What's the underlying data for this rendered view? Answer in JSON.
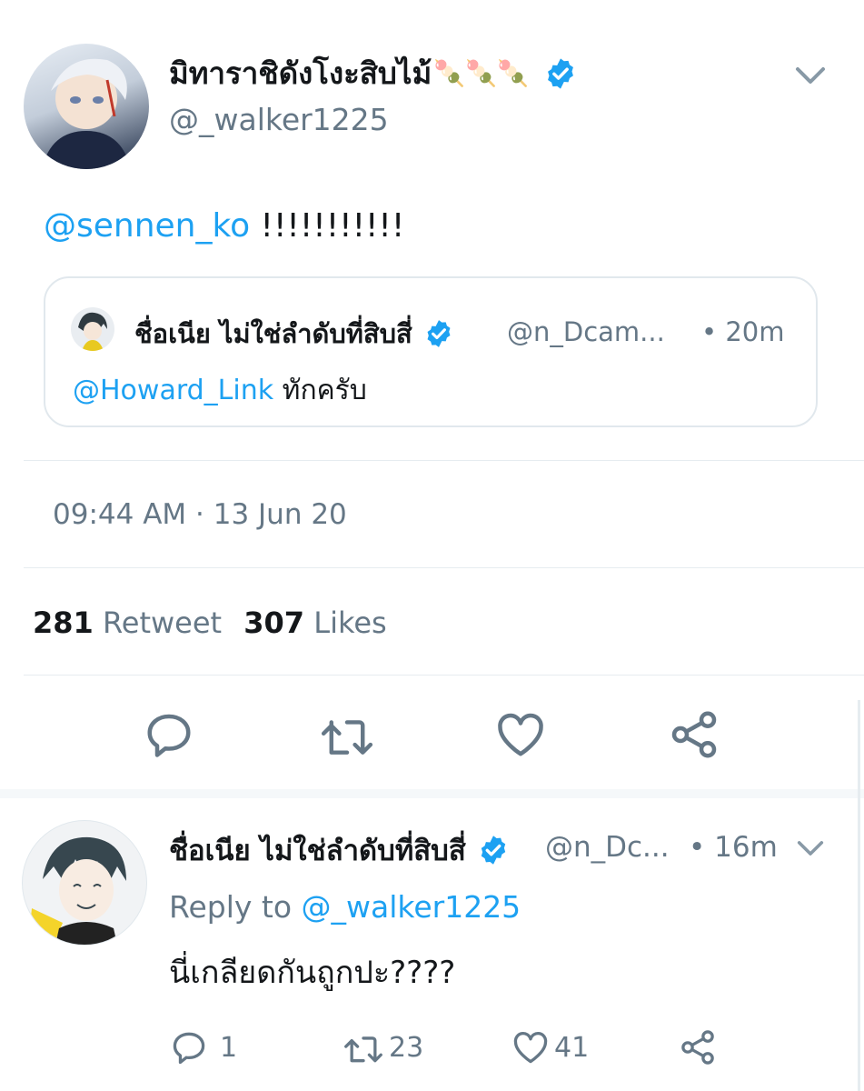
{
  "tweet": {
    "display_name": "มิทาราชิดังโงะสิบไม้",
    "name_emoji": "🍡🍡🍡",
    "handle": "@_walker1225",
    "mention": "@sennen_ko",
    "text_rest": "!!!!!!!!!!!",
    "timestamp": "09:44 AM",
    "date": "13 Jun 20",
    "retweet_count": "281",
    "retweet_label": "Retweet",
    "likes_count": "307",
    "likes_label": "Likes"
  },
  "quoted": {
    "display_name": "ชื่อเนีย ไม่ใช่ลำดับที่สิบสี่",
    "handle": "@n_Dcam...",
    "time": "• 20m",
    "mention": "@Howard_Link",
    "text_rest": "ทักครับ"
  },
  "reply": {
    "display_name": "ชื่อเนีย ไม่ใช่ลำดับที่สิบสี่",
    "handle": "@n_Dc...",
    "time": "• 16m",
    "reply_to_label": "Reply to",
    "reply_to_handle": "@_walker1225",
    "text": "นี่เกลียดกันถูกปะ????",
    "reply_count": "1",
    "retweet_count": "23",
    "like_count": "41"
  },
  "colors": {
    "accent": "#1da1f2",
    "muted": "#657786",
    "divider": "#e6ecf0"
  },
  "icons": {
    "caret": "chevron-down-icon",
    "verified": "verified-badge-icon",
    "reply": "reply-icon",
    "retweet": "retweet-icon",
    "like": "heart-icon",
    "share": "share-icon"
  }
}
